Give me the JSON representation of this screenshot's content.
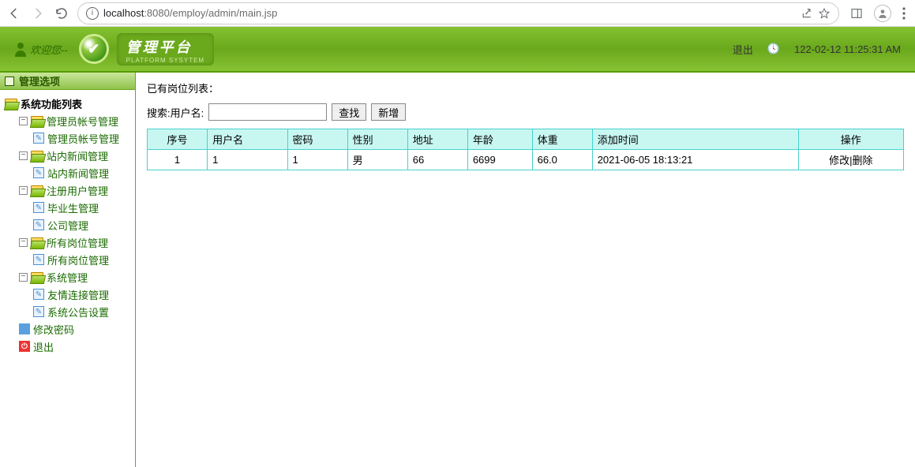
{
  "chrome": {
    "url_host": "localhost",
    "url_port": ":8080",
    "url_path": "/employ/admin/main.jsp"
  },
  "header": {
    "welcome": "欢迎您--",
    "title_zh": "管理平台",
    "title_en": "PLATFORM SYSYTEM",
    "logout": "退出",
    "clock": "122-02-12 11:25:31 AM"
  },
  "sidebar": {
    "options_label": "管理选项",
    "root": "系统功能列表",
    "groups": [
      {
        "label": "管理员帐号管理",
        "children": [
          {
            "label": "管理员帐号管理"
          }
        ]
      },
      {
        "label": "站内新闻管理",
        "children": [
          {
            "label": "站内新闻管理"
          }
        ]
      },
      {
        "label": "注册用户管理",
        "children": [
          {
            "label": "毕业生管理"
          },
          {
            "label": "公司管理"
          }
        ]
      },
      {
        "label": "所有岗位管理",
        "children": [
          {
            "label": "所有岗位管理"
          }
        ]
      },
      {
        "label": "系统管理",
        "children": [
          {
            "label": "友情连接管理"
          },
          {
            "label": "系统公告设置"
          }
        ]
      }
    ],
    "pwd": "修改密码",
    "exit": "退出"
  },
  "main": {
    "list_title": "已有岗位列表：",
    "search_label": "搜索:用户名:",
    "search_btn": "查找",
    "add_btn": "新增",
    "columns": [
      "序号",
      "用户名",
      "密码",
      "性别",
      "地址",
      "年龄",
      "体重",
      "添加时间",
      "操作"
    ],
    "rows": [
      {
        "idx": "1",
        "user": "1",
        "pwd": "1",
        "sex": "男",
        "addr": "66",
        "age": "6699",
        "weight": "66.0",
        "time": "2021-06-05 18:13:21",
        "op": "修改|删除"
      }
    ]
  }
}
